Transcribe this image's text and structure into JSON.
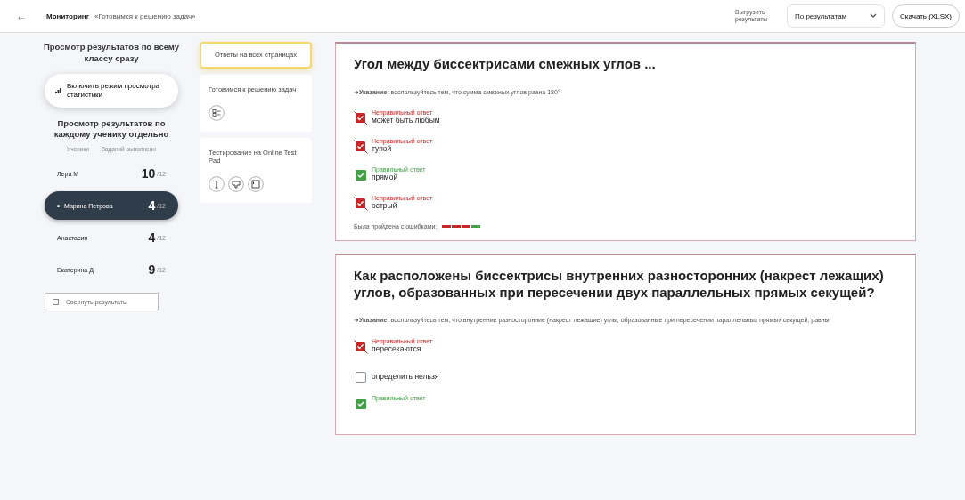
{
  "header": {
    "back": "←",
    "title": "Мониторинг",
    "subtitle": "«Готовимся к решению задач»",
    "export_label": "Выгрузить результаты",
    "sort": {
      "value": "По результатам"
    },
    "download": "Скачать (XLSX)"
  },
  "class_view": {
    "heading": "Просмотр результатов по всему классу сразу",
    "button": "Включить режим просмотра статистики"
  },
  "student_view": {
    "heading": "Просмотр результатов по каждому ученику отдельно",
    "columns": [
      "Ученики",
      "Заданий выполнено"
    ],
    "students": [
      {
        "name": "Лера М",
        "score": "10",
        "suffix": "/12",
        "selected": false
      },
      {
        "name": "Марина Петрова",
        "score": "4",
        "suffix": "/12",
        "selected": true
      },
      {
        "name": "Анастасия",
        "score": "4",
        "suffix": "/12",
        "selected": false
      },
      {
        "name": "Екатерина Д",
        "score": "9",
        "suffix": "/12",
        "selected": false
      }
    ],
    "collapse_button": "Свернуть результаты"
  },
  "sources": [
    {
      "kind": "summary",
      "title": "Ответы на всех страницах",
      "selected": true
    },
    {
      "kind": "lesson",
      "title": "Готовимся к решению задач",
      "selected": false
    },
    {
      "kind": "test",
      "title": "Тестирование на Online Test Pad",
      "selected": false
    }
  ],
  "questions": [
    {
      "title": "Угол между биссектрисами смежных углов ...",
      "hint": "➜**Указание:** воспользуйтесь тем, что сумма смежных углов равна 180°",
      "answers": [
        {
          "kind": "incorrect",
          "label": "Неправильный ответ",
          "text": "может быть любым"
        },
        {
          "kind": "incorrect",
          "label": "Неправильный ответ",
          "text": "тупой"
        },
        {
          "kind": "correct",
          "label": "Правильный ответ",
          "text": "прямой"
        },
        {
          "kind": "incorrect",
          "label": "Неправильный ответ",
          "text": "острый"
        }
      ],
      "progress": {
        "label": "Была пройдена с ошибками:",
        "segments": [
          {
            "color": "#c62828"
          },
          {
            "color": "#c62828"
          },
          {
            "color": "#c62828"
          },
          {
            "color": "#43a047"
          }
        ]
      }
    },
    {
      "title": "Как расположены биссектрисы внутренних разносторонних (накрест лежащих) углов, образованных при пересечении двух параллельных прямых секущей?",
      "hint": "➜**Указание:** воспользуйтесь тем, что внутренние разносторонние (накрест лежащие) углы, образованные при пересечении параллельных прямых секущей, равны",
      "answers": [
        {
          "kind": "incorrect",
          "label": "Неправильный ответ",
          "text": "пересекаются"
        },
        {
          "kind": "none",
          "text": "определить нельзя"
        },
        {
          "kind": "correct",
          "label": "Правильный ответ"
        }
      ]
    }
  ]
}
